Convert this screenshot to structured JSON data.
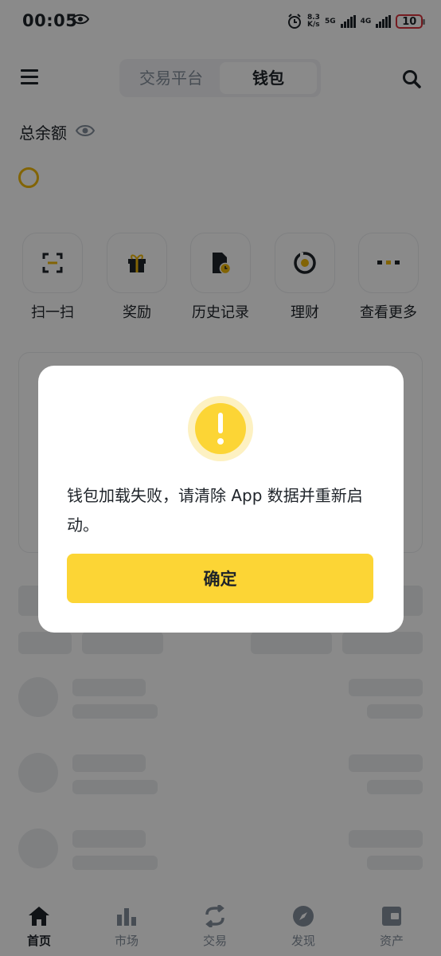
{
  "status_bar": {
    "time": "00:05",
    "net_speed_value": "8.3",
    "net_speed_unit": "K/s",
    "network_1": "5G",
    "network_2": "4G",
    "battery": "10"
  },
  "header": {
    "tabs": [
      {
        "label": "交易平台",
        "active": false
      },
      {
        "label": "钱包",
        "active": true
      }
    ]
  },
  "balance": {
    "label": "总余额"
  },
  "quick_actions": [
    {
      "label": "扫一扫",
      "icon": "scan-icon"
    },
    {
      "label": "奖励",
      "icon": "gift-icon"
    },
    {
      "label": "历史记录",
      "icon": "history-icon"
    },
    {
      "label": "理财",
      "icon": "earn-icon"
    },
    {
      "label": "查看更多",
      "icon": "more-icon"
    }
  ],
  "bottom_nav": [
    {
      "label": "首页",
      "icon": "home-icon",
      "active": true
    },
    {
      "label": "市场",
      "icon": "markets-icon",
      "active": false
    },
    {
      "label": "交易",
      "icon": "trade-icon",
      "active": false
    },
    {
      "label": "发现",
      "icon": "discover-icon",
      "active": false
    },
    {
      "label": "资产",
      "icon": "wallet-icon",
      "active": false
    }
  ],
  "dialog": {
    "message": "钱包加载失败，请清除 App 数据并重新启动。",
    "confirm_label": "确定",
    "icon": "warning-icon"
  },
  "colors": {
    "brand": "#FCD535",
    "text": "#1E2329",
    "muted": "#848E9C"
  }
}
